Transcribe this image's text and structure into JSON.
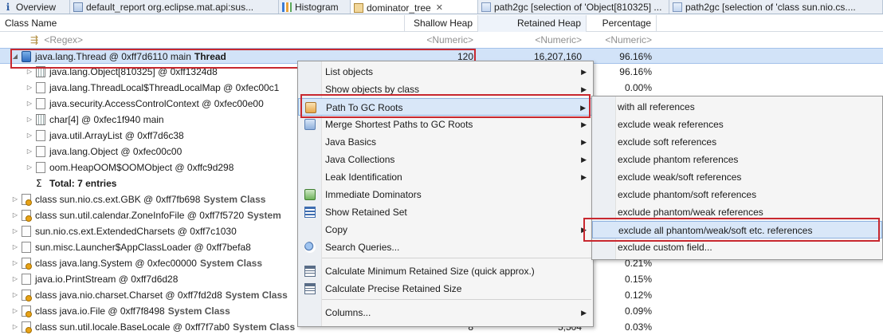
{
  "tabs": [
    {
      "label": "Overview",
      "icon": "info-icon"
    },
    {
      "label": "default_report  org.eclipse.mat.api:sus...",
      "icon": "report-icon"
    },
    {
      "label": "Histogram",
      "icon": "histogram-icon"
    },
    {
      "label": "dominator_tree",
      "icon": "dominator-tree-icon",
      "close": "✕",
      "active": true
    },
    {
      "label": "path2gc [selection of 'Object[810325] ...",
      "icon": "path-to-gc-icon"
    },
    {
      "label": "path2gc [selection of 'class sun.nio.cs....",
      "icon": "path-to-gc-icon"
    }
  ],
  "columns": {
    "class_name": "Class Name",
    "shallow_heap": "Shallow Heap",
    "retained_heap": "Retained Heap",
    "percentage": "Percentage"
  },
  "filter": {
    "regex": "<Regex>",
    "numeric": "<Numeric>"
  },
  "rows": [
    {
      "exp": "◢",
      "icon": "thread-icon",
      "name": "java.lang.Thread @ 0xff7d6110  main ",
      "suffix": "Thread",
      "shallow": "120",
      "retained": "16,207,160",
      "pct": "96.16%"
    },
    {
      "exp": "▷",
      "icon": "array-icon",
      "name": "java.lang.Object[810325] @ 0xff1324d8",
      "suffix": "",
      "shallow": "",
      "retained": "",
      "pct": "96.16%"
    },
    {
      "exp": "▷",
      "icon": "object-icon",
      "name": "java.lang.ThreadLocal$ThreadLocalMap @ 0xfec00c1",
      "suffix": "",
      "shallow": "",
      "retained": "",
      "pct": "0.00%"
    },
    {
      "exp": "▷",
      "icon": "object-icon",
      "name": "java.security.AccessControlContext @ 0xfec00e00",
      "suffix": "",
      "shallow": "",
      "retained": "",
      "pct": ""
    },
    {
      "exp": "▷",
      "icon": "array-icon",
      "name": "char[4] @ 0xfec1f940  main",
      "suffix": "",
      "shallow": "",
      "retained": "",
      "pct": ""
    },
    {
      "exp": "▷",
      "icon": "object-icon",
      "name": "java.util.ArrayList @ 0xff7d6c38",
      "suffix": "",
      "shallow": "",
      "retained": "",
      "pct": ""
    },
    {
      "exp": "▷",
      "icon": "object-icon",
      "name": "java.lang.Object @ 0xfec00c00",
      "suffix": "",
      "shallow": "",
      "retained": "",
      "pct": ""
    },
    {
      "exp": "▷",
      "icon": "object-icon",
      "name": "oom.HeapOOM$OOMObject @ 0xffc9d298",
      "suffix": "",
      "shallow": "",
      "retained": "",
      "pct": ""
    },
    {
      "exp": "",
      "icon": "sigma-icon",
      "name": "Total: 7 entries",
      "suffix": "",
      "shallow": "",
      "retained": "",
      "pct": "",
      "total": true
    },
    {
      "exp": "▷",
      "icon": "class-icon",
      "name": "class sun.nio.cs.ext.GBK @ 0xff7fb698 ",
      "suffix": "System Class",
      "shallow": "",
      "retained": "",
      "pct": ""
    },
    {
      "exp": "▷",
      "icon": "class-icon",
      "name": "class sun.util.calendar.ZoneInfoFile @ 0xff7f5720 ",
      "suffix": "System",
      "shallow": "",
      "retained": "",
      "pct": ""
    },
    {
      "exp": "▷",
      "icon": "object-icon",
      "name": "sun.nio.cs.ext.ExtendedCharsets @ 0xff7c1030",
      "suffix": "",
      "shallow": "",
      "retained": "",
      "pct": ""
    },
    {
      "exp": "▷",
      "icon": "object-icon",
      "name": "sun.misc.Launcher$AppClassLoader @ 0xff7befa8",
      "suffix": "",
      "shallow": "",
      "retained": "",
      "pct": ""
    },
    {
      "exp": "▷",
      "icon": "class-icon",
      "name": "class java.lang.System @ 0xfec00000 ",
      "suffix": "System Class",
      "shallow": "",
      "retained": "",
      "pct": "0.21%"
    },
    {
      "exp": "▷",
      "icon": "object-icon",
      "name": "java.io.PrintStream @ 0xff7d6d28",
      "suffix": "",
      "shallow": "",
      "retained": "",
      "pct": "0.15%"
    },
    {
      "exp": "▷",
      "icon": "class-icon",
      "name": "class java.nio.charset.Charset @ 0xff7fd2d8 ",
      "suffix": "System Class",
      "shallow": "",
      "retained": "",
      "pct": "0.12%"
    },
    {
      "exp": "▷",
      "icon": "class-icon",
      "name": "class java.io.File @ 0xff7f8498 ",
      "suffix": "System Class",
      "shallow": "",
      "retained": "",
      "pct": "0.09%"
    },
    {
      "exp": "▷",
      "icon": "class-icon",
      "name": "class sun.util.locale.BaseLocale @ 0xff7f7ab0 ",
      "suffix": "System Class",
      "shallow": "8",
      "retained": "5,504",
      "pct": "0.03%"
    }
  ],
  "context_menu": {
    "items": [
      {
        "label": "List objects",
        "icon": "",
        "arrow": "▶"
      },
      {
        "label": "Show objects by class",
        "icon": "",
        "arrow": "▶"
      },
      {
        "label": "Path To GC Roots",
        "icon": "path-to-gc-icon",
        "arrow": "▶",
        "highlighted": true
      },
      {
        "label": "Merge Shortest Paths to GC Roots",
        "icon": "merge-paths-icon",
        "arrow": "▶"
      },
      {
        "label": "Java Basics",
        "icon": "",
        "arrow": "▶"
      },
      {
        "label": "Java Collections",
        "icon": "",
        "arrow": "▶"
      },
      {
        "label": "Leak Identification",
        "icon": "",
        "arrow": "▶"
      },
      {
        "label": "Immediate Dominators",
        "icon": "immediate-dominators-icon",
        "arrow": ""
      },
      {
        "label": "Show Retained Set",
        "icon": "retained-set-icon",
        "arrow": ""
      },
      {
        "label": "Copy",
        "icon": "",
        "arrow": "▶"
      },
      {
        "label": "Search Queries...",
        "icon": "search-queries-icon",
        "arrow": ""
      },
      {
        "label": "Calculate Minimum Retained Size (quick approx.)",
        "icon": "calculator-icon",
        "arrow": ""
      },
      {
        "label": "Calculate Precise Retained Size",
        "icon": "calculator-icon",
        "arrow": ""
      },
      {
        "label": "Columns...",
        "icon": "",
        "arrow": "▶"
      }
    ]
  },
  "submenu": {
    "items": [
      {
        "label": "with all references"
      },
      {
        "label": "exclude weak references"
      },
      {
        "label": "exclude soft references"
      },
      {
        "label": "exclude phantom references"
      },
      {
        "label": "exclude weak/soft references"
      },
      {
        "label": "exclude phantom/soft references"
      },
      {
        "label": "exclude phantom/weak references"
      },
      {
        "label": "exclude all phantom/weak/soft etc. references",
        "highlighted": true
      },
      {
        "label": "exclude custom field..."
      }
    ]
  }
}
